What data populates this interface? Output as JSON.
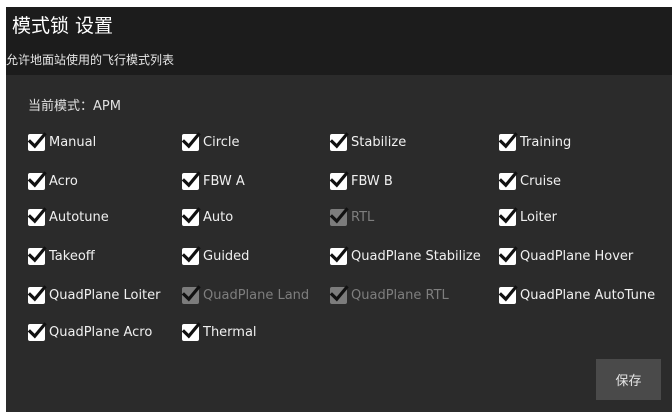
{
  "header": {
    "title": "模式锁 设置",
    "subtitle": "允许地面站使用的飞行模式列表"
  },
  "current_mode": "当前模式：APM",
  "modes": [
    {
      "label": "Manual",
      "checked": true,
      "enabled": true
    },
    {
      "label": "Circle",
      "checked": true,
      "enabled": true
    },
    {
      "label": "Stabilize",
      "checked": true,
      "enabled": true
    },
    {
      "label": "Training",
      "checked": true,
      "enabled": true
    },
    {
      "label": "Acro",
      "checked": true,
      "enabled": true
    },
    {
      "label": "FBW A",
      "checked": true,
      "enabled": true
    },
    {
      "label": "FBW B",
      "checked": true,
      "enabled": true
    },
    {
      "label": "Cruise",
      "checked": true,
      "enabled": true
    },
    {
      "label": "Autotune",
      "checked": true,
      "enabled": true
    },
    {
      "label": "Auto",
      "checked": true,
      "enabled": true
    },
    {
      "label": "RTL",
      "checked": true,
      "enabled": false
    },
    {
      "label": "Loiter",
      "checked": true,
      "enabled": true
    },
    {
      "label": "Takeoff",
      "checked": true,
      "enabled": true
    },
    {
      "label": "Guided",
      "checked": true,
      "enabled": true
    },
    {
      "label": "QuadPlane Stabilize",
      "checked": true,
      "enabled": true
    },
    {
      "label": "QuadPlane Hover",
      "checked": true,
      "enabled": true
    },
    {
      "label": "QuadPlane Loiter",
      "checked": true,
      "enabled": true
    },
    {
      "label": "QuadPlane Land",
      "checked": true,
      "enabled": false
    },
    {
      "label": "QuadPlane RTL",
      "checked": true,
      "enabled": false
    },
    {
      "label": "QuadPlane AutoTune",
      "checked": true,
      "enabled": true
    },
    {
      "label": "QuadPlane Acro",
      "checked": true,
      "enabled": true
    },
    {
      "label": "Thermal",
      "checked": true,
      "enabled": true
    }
  ],
  "save_label": "保存"
}
